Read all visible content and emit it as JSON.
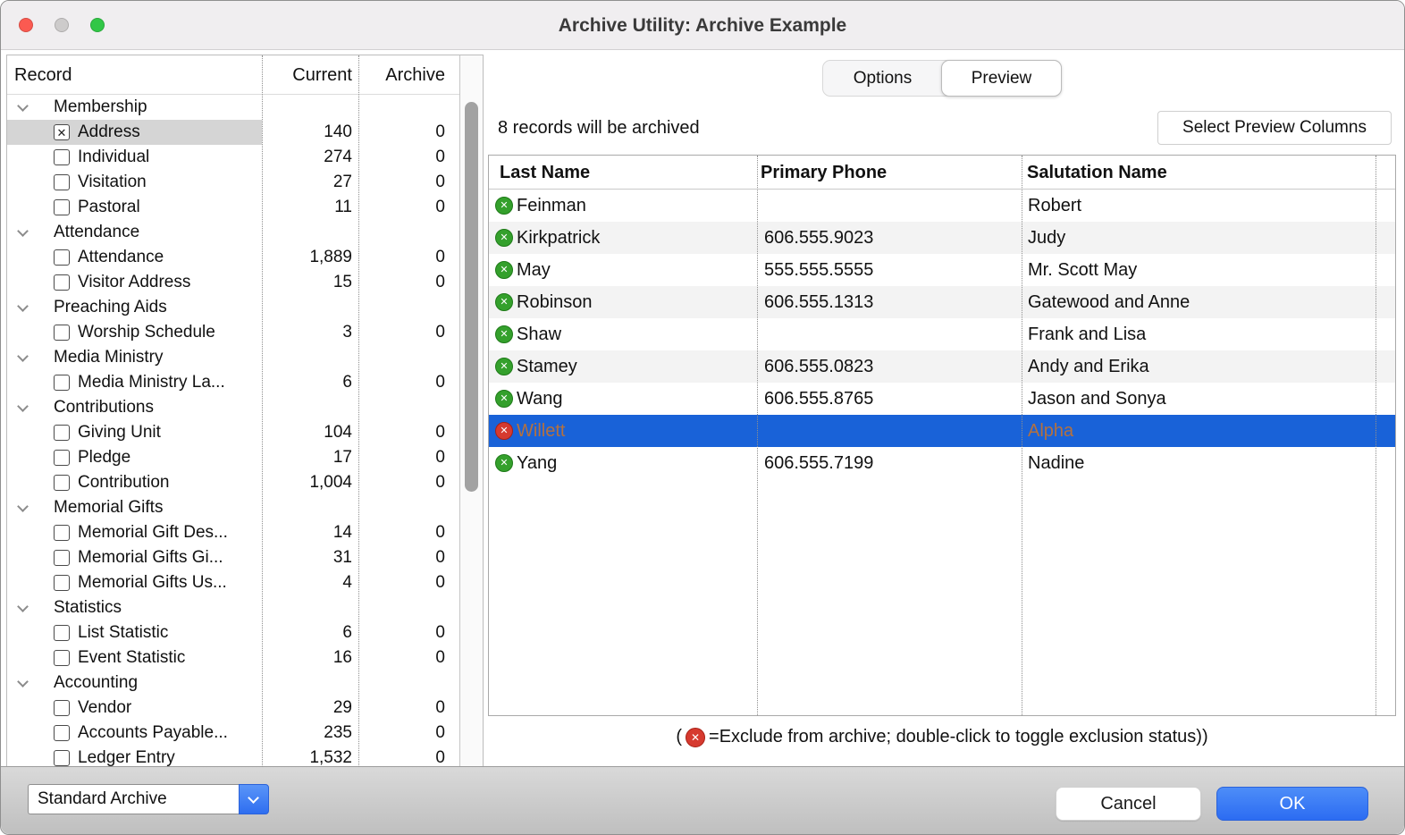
{
  "window": {
    "title": "Archive Utility: Archive Example"
  },
  "colors": {
    "selection_blue": "#1962d8",
    "excluded_text_on_selection": "#b4713f",
    "include_green": "#34a02c",
    "exclude_red": "#d63a2f",
    "ok_button_blue": "#3478f6",
    "titlebar_gray": "#f0eef0"
  },
  "icons": {
    "include": "green-circle-x",
    "exclude": "red-circle-x",
    "group_chevron": "chevron-down",
    "combo_chevron": "chevron-down"
  },
  "left_panel": {
    "columns": {
      "record": "Record",
      "current": "Current",
      "archive": "Archive"
    },
    "tree": [
      {
        "type": "group",
        "label": "Membership"
      },
      {
        "type": "item",
        "label": "Address",
        "current": "140",
        "archive": "0",
        "checked": true,
        "selected": true
      },
      {
        "type": "item",
        "label": "Individual",
        "current": "274",
        "archive": "0"
      },
      {
        "type": "item",
        "label": "Visitation",
        "current": "27",
        "archive": "0"
      },
      {
        "type": "item",
        "label": "Pastoral",
        "current": "11",
        "archive": "0"
      },
      {
        "type": "group",
        "label": "Attendance"
      },
      {
        "type": "item",
        "label": "Attendance",
        "current": "1,889",
        "archive": "0"
      },
      {
        "type": "item",
        "label": "Visitor Address",
        "current": "15",
        "archive": "0"
      },
      {
        "type": "group",
        "label": "Preaching Aids"
      },
      {
        "type": "item",
        "label": "Worship Schedule",
        "current": "3",
        "archive": "0"
      },
      {
        "type": "group",
        "label": "Media Ministry"
      },
      {
        "type": "item",
        "label": "Media Ministry La...",
        "current": "6",
        "archive": "0"
      },
      {
        "type": "group",
        "label": "Contributions"
      },
      {
        "type": "item",
        "label": "Giving Unit",
        "current": "104",
        "archive": "0"
      },
      {
        "type": "item",
        "label": "Pledge",
        "current": "17",
        "archive": "0"
      },
      {
        "type": "item",
        "label": "Contribution",
        "current": "1,004",
        "archive": "0"
      },
      {
        "type": "group",
        "label": "Memorial Gifts"
      },
      {
        "type": "item",
        "label": "Memorial Gift Des...",
        "current": "14",
        "archive": "0"
      },
      {
        "type": "item",
        "label": "Memorial Gifts Gi...",
        "current": "31",
        "archive": "0"
      },
      {
        "type": "item",
        "label": "Memorial Gifts Us...",
        "current": "4",
        "archive": "0"
      },
      {
        "type": "group",
        "label": "Statistics"
      },
      {
        "type": "item",
        "label": "List Statistic",
        "current": "6",
        "archive": "0"
      },
      {
        "type": "item",
        "label": "Event Statistic",
        "current": "16",
        "archive": "0"
      },
      {
        "type": "group",
        "label": "Accounting"
      },
      {
        "type": "item",
        "label": "Vendor",
        "current": "29",
        "archive": "0"
      },
      {
        "type": "item",
        "label": "Accounts Payable...",
        "current": "235",
        "archive": "0"
      },
      {
        "type": "item",
        "label": "Ledger Entry",
        "current": "1,532",
        "archive": "0"
      }
    ]
  },
  "right_panel": {
    "tabs": [
      {
        "label": "Options",
        "active": false
      },
      {
        "label": "Preview",
        "active": true
      }
    ],
    "summary": "8 records will be archived",
    "select_columns_button": "Select Preview Columns",
    "table": {
      "columns": [
        "Last Name",
        "Primary Phone",
        "Salutation Name"
      ],
      "rows": [
        {
          "last_name": "Feinman",
          "phone": "",
          "salutation": "Robert",
          "excluded": false
        },
        {
          "last_name": "Kirkpatrick",
          "phone": "606.555.9023",
          "salutation": "Judy",
          "excluded": false
        },
        {
          "last_name": "May",
          "phone": "555.555.5555",
          "salutation": "Mr. Scott May",
          "excluded": false
        },
        {
          "last_name": "Robinson",
          "phone": "606.555.1313",
          "salutation": "Gatewood and Anne",
          "excluded": false
        },
        {
          "last_name": "Shaw",
          "phone": "",
          "salutation": "Frank and Lisa",
          "excluded": false
        },
        {
          "last_name": "Stamey",
          "phone": "606.555.0823",
          "salutation": "Andy and Erika",
          "excluded": false
        },
        {
          "last_name": "Wang",
          "phone": "606.555.8765",
          "salutation": "Jason and Sonya",
          "excluded": false
        },
        {
          "last_name": "Willett",
          "phone": "",
          "salutation": "Alpha",
          "excluded": true,
          "selected": true
        },
        {
          "last_name": "Yang",
          "phone": "606.555.7199",
          "salutation": "Nadine",
          "excluded": false
        }
      ]
    },
    "legend": {
      "prefix": "(",
      "text": "=Exclude from archive; double-click to toggle exclusion status))"
    }
  },
  "footer": {
    "archive_select_value": "Standard Archive",
    "cancel_label": "Cancel",
    "ok_label": "OK"
  }
}
